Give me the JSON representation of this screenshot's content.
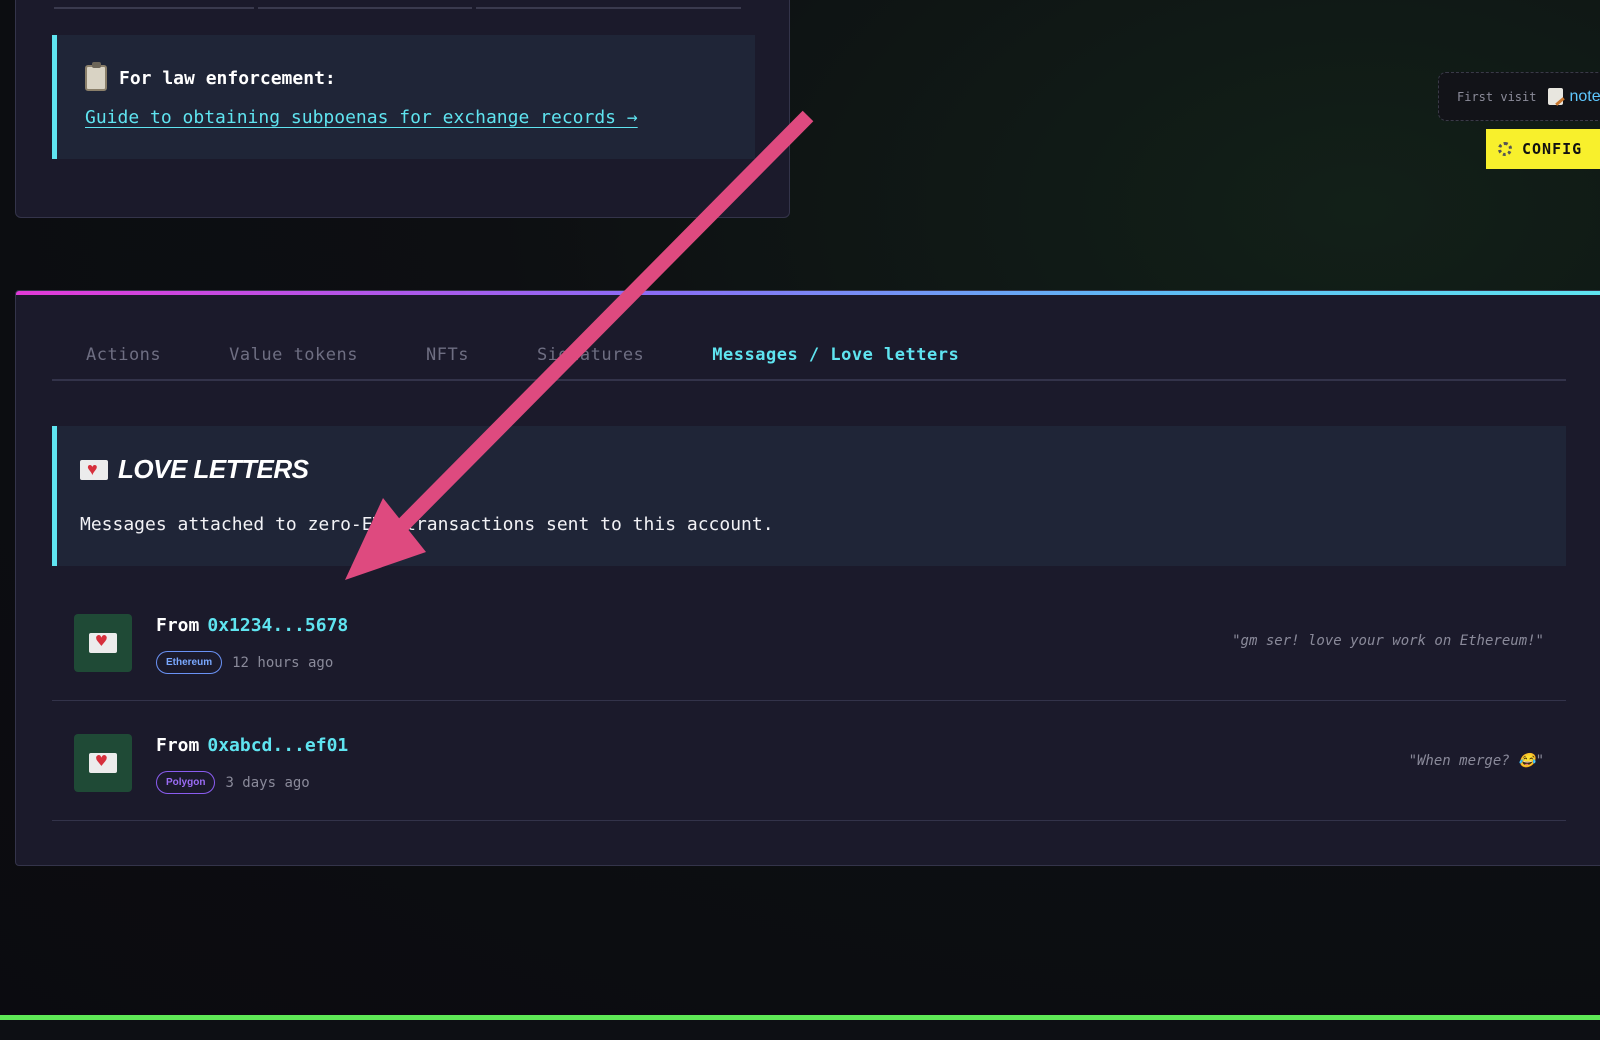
{
  "law_enforcement": {
    "title": "For law enforcement:",
    "link_text": "Guide to obtaining subpoenas for exchange records →",
    "icon": "clipboard-icon"
  },
  "first_visit": {
    "label": "First visit",
    "note_label": "note",
    "icon": "memo-icon"
  },
  "config": {
    "label": "CONFIG",
    "icon": "gear-icon",
    "color": "#f8f02c"
  },
  "tabs": [
    {
      "label": "Actions",
      "active": false
    },
    {
      "label": "Value tokens",
      "active": false
    },
    {
      "label": "NFTs",
      "active": false
    },
    {
      "label": "Signatures",
      "active": false
    },
    {
      "label": "Messages / Love letters",
      "active": true
    }
  ],
  "love_letters": {
    "title": "LOVE LETTERS",
    "description": "Messages attached to zero-ETH transactions sent to this account.",
    "icon": "love-letter-icon"
  },
  "messages": [
    {
      "from_label": "From",
      "address": "0x1234...5678",
      "chain": "Ethereum",
      "time": "12 hours ago",
      "quote": "\"gm ser! love your work on Ethereum!\""
    },
    {
      "from_label": "From",
      "address": "0xabcd...ef01",
      "chain": "Polygon",
      "time": "3 days ago",
      "quote": "\"When merge? 😂\""
    }
  ],
  "colors": {
    "accent_cyan": "#5fe4f0",
    "annotation_arrow": "#de4a7f",
    "bottom_line": "#5ee856"
  }
}
